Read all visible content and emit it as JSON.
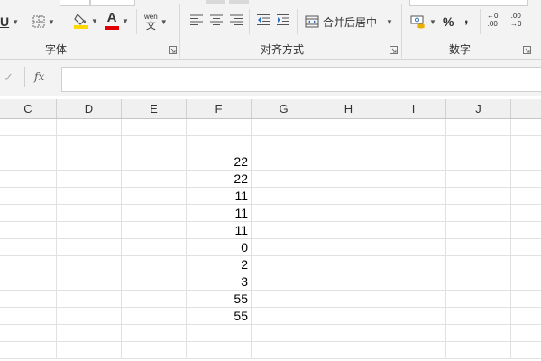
{
  "ribbon": {
    "font_group": {
      "label": "字体",
      "underline": "U",
      "font_color_letter": "A",
      "phonetic_top": "wén",
      "phonetic_bottom": "文",
      "highlight_color": "#ffd800",
      "font_color": "#e00000"
    },
    "alignment_group": {
      "label": "对齐方式",
      "merge_center": "合并后居中"
    },
    "number_group": {
      "label": "数字",
      "percent": "%",
      "comma": ",",
      "inc_decimal_top": "←0",
      "inc_decimal_bottom": ".00",
      "dec_decimal_top": ".00",
      "dec_decimal_bottom": "→0"
    }
  },
  "formula_bar": {
    "cancel_symbol": "✓",
    "fx_label": "fx",
    "value": ""
  },
  "columns": [
    "C",
    "D",
    "E",
    "F",
    "G",
    "H",
    "I",
    "J"
  ],
  "column_f_values": [
    "",
    "",
    "22",
    "22",
    "11",
    "11",
    "11",
    "0",
    "2",
    "3",
    "55",
    "55",
    "",
    ""
  ]
}
